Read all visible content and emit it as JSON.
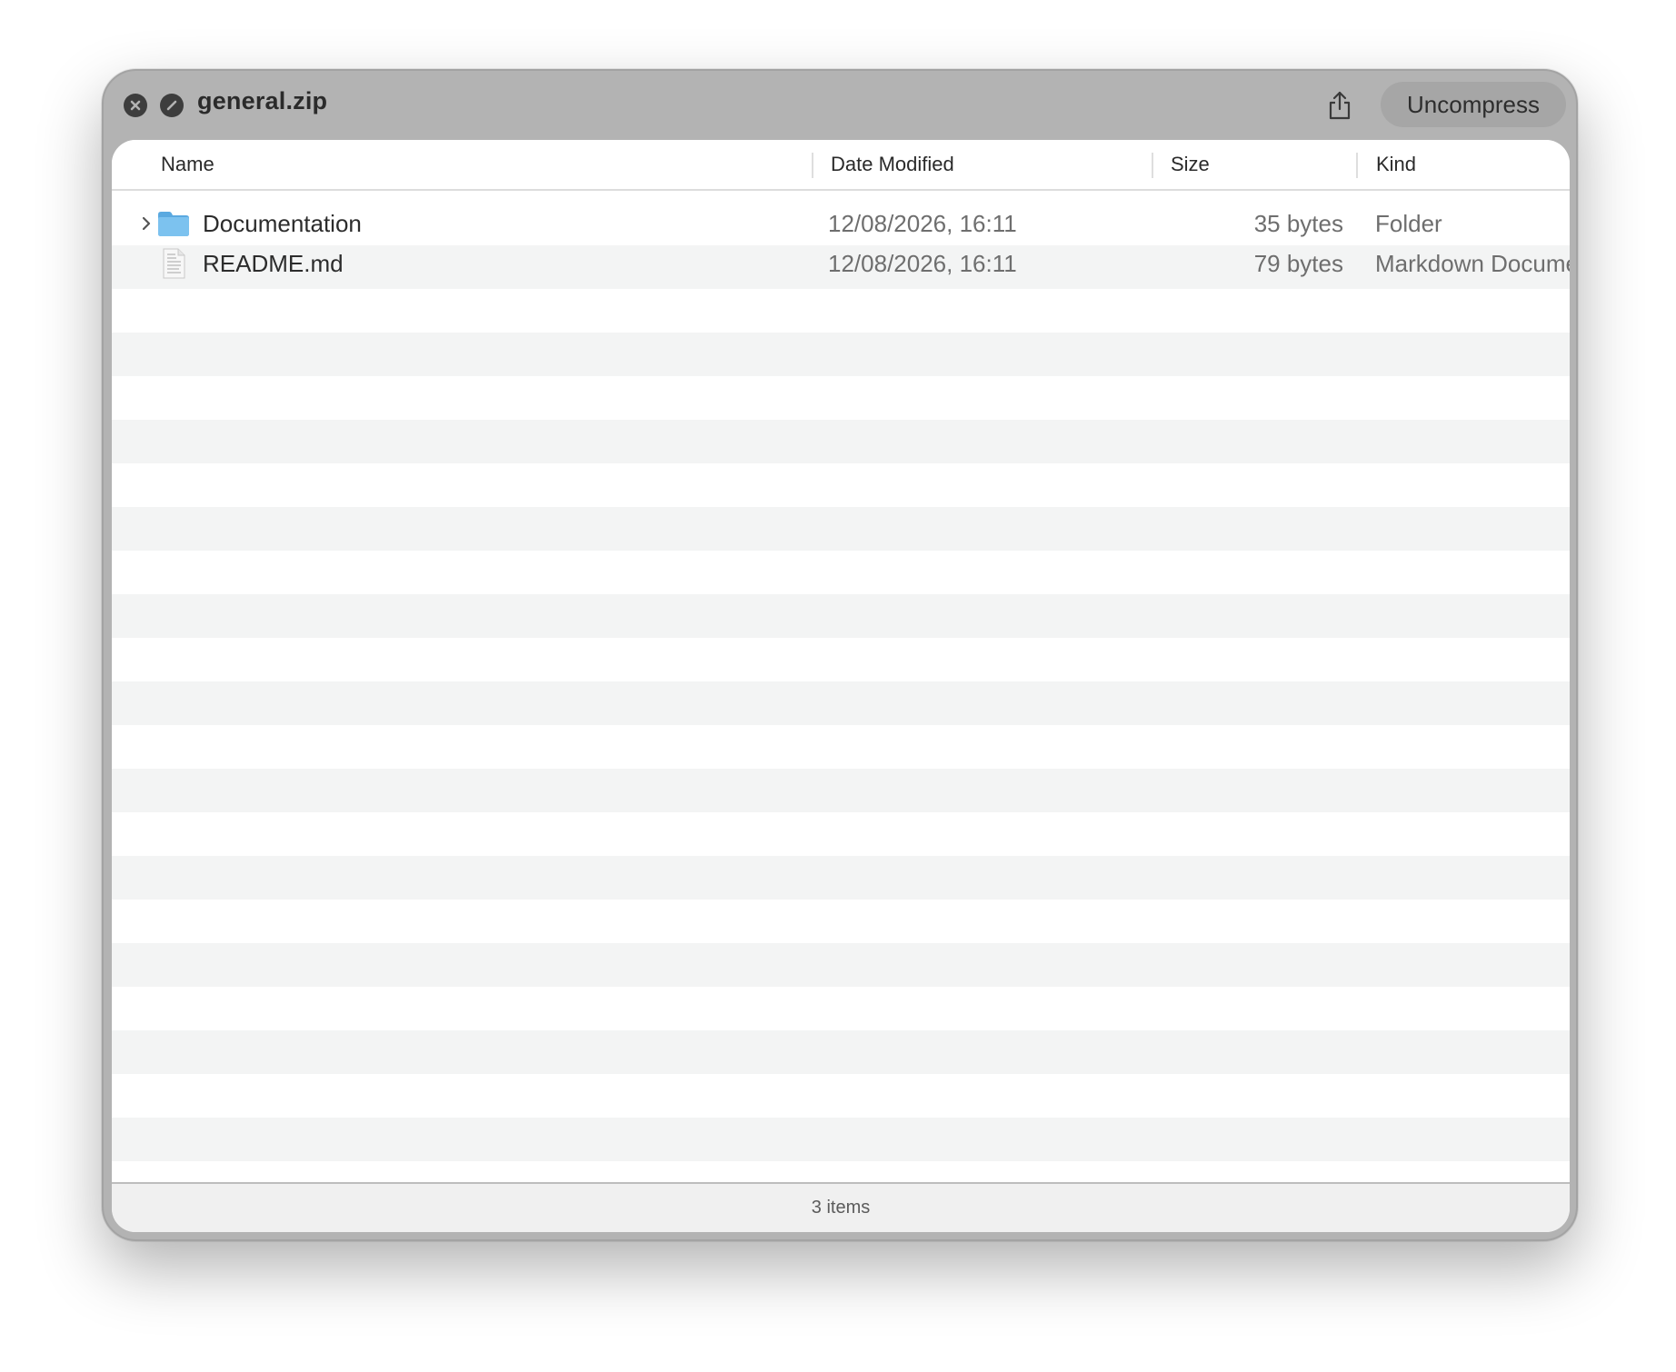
{
  "window": {
    "title": "general.zip",
    "uncompress_label": "Uncompress"
  },
  "columns": {
    "name": "Name",
    "date": "Date Modified",
    "size": "Size",
    "kind": "Kind"
  },
  "items": [
    {
      "name": "Documentation",
      "date": "12/08/2026, 16:11",
      "size": "35 bytes",
      "kind": "Folder",
      "icon": "folder-icon",
      "expandable": true
    },
    {
      "name": "README.md",
      "date": "12/08/2026, 16:11",
      "size": "79 bytes",
      "kind": "Markdown Document",
      "icon": "document-icon",
      "expandable": false
    }
  ],
  "footer": {
    "status": "3 items"
  },
  "colors": {
    "titlebar": "#b3b3b3",
    "stripe": "#f3f4f4",
    "folder_blue": "#6fb8ea"
  }
}
